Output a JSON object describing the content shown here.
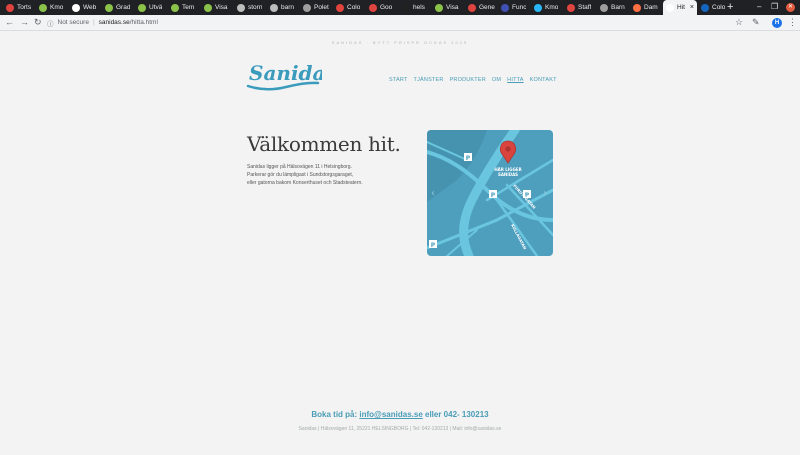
{
  "browser": {
    "tabs": [
      {
        "title": "Torts",
        "color": "#e0443e"
      },
      {
        "title": "Kmo",
        "color": "#8bc34a"
      },
      {
        "title": "Web",
        "color": "#ffffff"
      },
      {
        "title": "Grad",
        "color": "#8bc34a"
      },
      {
        "title": "Utvä",
        "color": "#8bc34a"
      },
      {
        "title": "Tem",
        "color": "#8bc34a"
      },
      {
        "title": "Visa",
        "color": "#8bc34a"
      },
      {
        "title": "storn",
        "color": "#bdbdbd"
      },
      {
        "title": "barn",
        "color": "#bdbdbd"
      },
      {
        "title": "Polet",
        "color": "#9e9e9e"
      },
      {
        "title": "Colo",
        "color": "#e0443e"
      },
      {
        "title": "Goo",
        "color": "#e0443e"
      },
      {
        "title": "hels",
        "color": "#212121"
      },
      {
        "title": "Visa",
        "color": "#8bc34a"
      },
      {
        "title": "Gene",
        "color": "#e0443e"
      },
      {
        "title": "Func",
        "color": "#3f51b5"
      },
      {
        "title": "Kmo",
        "color": "#29b6f6"
      },
      {
        "title": "Staff",
        "color": "#e0443e"
      },
      {
        "title": "Barn",
        "color": "#9e9e9e"
      },
      {
        "title": "Dam",
        "color": "#ff7043"
      },
      {
        "title": "Hit",
        "color": "#ffffff",
        "active": true
      },
      {
        "title": "Colo",
        "color": "#1565c0"
      }
    ],
    "new_tab": "+",
    "controls": {
      "minimize": "–",
      "maximize": "❐",
      "close": "✕"
    },
    "toolbar": {
      "back": "←",
      "forward": "→",
      "reload": "↻",
      "info": "ⓘ",
      "security_label": "Not secure",
      "separator": "|",
      "url_host": "sanidas.se",
      "url_path": "/hitta.html",
      "star": "☆",
      "extension": "✎",
      "profile_initial": "H",
      "menu": "⋮"
    }
  },
  "page": {
    "tagline": "SANIDAS · BYTT PRISPR OCKAS 2015",
    "logo_text": "Sanidas",
    "nav": [
      {
        "label": "START",
        "current": false
      },
      {
        "label": "TJÄNSTER",
        "current": false
      },
      {
        "label": "PRODUKTER",
        "current": false
      },
      {
        "label": "OM",
        "current": false
      },
      {
        "label": "HITTA",
        "current": true
      },
      {
        "label": "KONTAKT",
        "current": false
      }
    ],
    "headline": "Välkommen hit.",
    "description": [
      "Sanidas ligger på Hälsovägen 11 i Helsingborg.",
      "Parkerar gör du lämpligast i Sundstorgsgaraget,",
      "eller gatorna bakom Konserthuset och Stadsteatern."
    ],
    "map": {
      "here_label_1": "HÄR LIGGER",
      "here_label_2": "SANIDAS",
      "street_1": "FURUTSGATAN",
      "street_2": "HALSOVÄGEN",
      "street_3": "KULLAGATAN",
      "parking": "P",
      "prev": "‹",
      "next": "›",
      "colors": {
        "water": "#4e9fbd",
        "road": "#6ac6de",
        "pin": "#d9443f"
      }
    },
    "booking": {
      "prefix": "Boka tid på: ",
      "email": "info@sanidas.se",
      "suffix": " eller 042- 130213"
    },
    "footer": "Sanidas | Hälsovägen 11, 25221 HELSINGBORG | Tel: 042-130213 | Mail: info@sanidas.se"
  }
}
